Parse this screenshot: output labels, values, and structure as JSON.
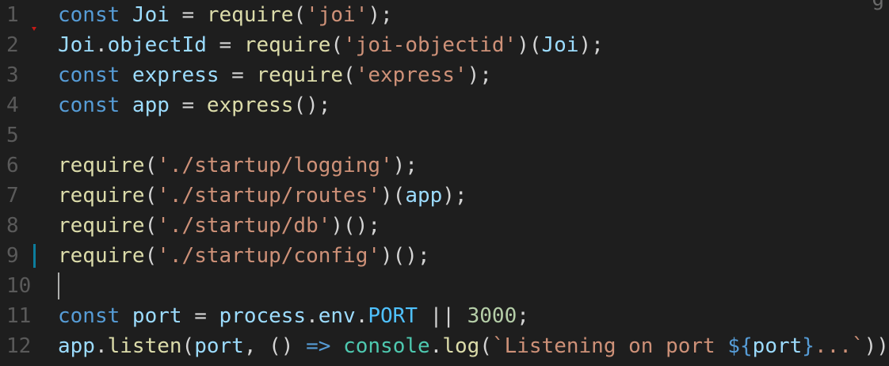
{
  "editor": {
    "corner_glyph": "g",
    "lines": [
      {
        "number": "1",
        "tokens": [
          [
            "k",
            "const "
          ],
          [
            "v",
            "Joi"
          ],
          [
            "p",
            " = "
          ],
          [
            "f",
            "require"
          ],
          [
            "p",
            "("
          ],
          [
            "s",
            "'joi'"
          ],
          [
            "p",
            ");"
          ]
        ]
      },
      {
        "number": "2",
        "tokens": [
          [
            "v",
            "Joi"
          ],
          [
            "p",
            "."
          ],
          [
            "v",
            "objectId"
          ],
          [
            "p",
            " = "
          ],
          [
            "f",
            "require"
          ],
          [
            "p",
            "("
          ],
          [
            "s",
            "'joi-objectid'"
          ],
          [
            "p",
            ")("
          ],
          [
            "v",
            "Joi"
          ],
          [
            "p",
            ");"
          ]
        ]
      },
      {
        "number": "3",
        "tokens": [
          [
            "k",
            "const "
          ],
          [
            "v",
            "express"
          ],
          [
            "p",
            " = "
          ],
          [
            "f",
            "require"
          ],
          [
            "p",
            "("
          ],
          [
            "s",
            "'express'"
          ],
          [
            "p",
            ");"
          ]
        ]
      },
      {
        "number": "4",
        "tokens": [
          [
            "k",
            "const "
          ],
          [
            "v",
            "app"
          ],
          [
            "p",
            " = "
          ],
          [
            "f",
            "express"
          ],
          [
            "p",
            "();"
          ]
        ]
      },
      {
        "number": "5",
        "tokens": []
      },
      {
        "number": "6",
        "tokens": [
          [
            "f",
            "require"
          ],
          [
            "p",
            "("
          ],
          [
            "s",
            "'./startup/logging'"
          ],
          [
            "p",
            ");"
          ]
        ]
      },
      {
        "number": "7",
        "tokens": [
          [
            "f",
            "require"
          ],
          [
            "p",
            "("
          ],
          [
            "s",
            "'./startup/routes'"
          ],
          [
            "p",
            ")("
          ],
          [
            "v",
            "app"
          ],
          [
            "p",
            ");"
          ]
        ]
      },
      {
        "number": "8",
        "tokens": [
          [
            "f",
            "require"
          ],
          [
            "p",
            "("
          ],
          [
            "s",
            "'./startup/db'"
          ],
          [
            "p",
            ")();"
          ]
        ]
      },
      {
        "number": "9",
        "tokens": [
          [
            "f",
            "require"
          ],
          [
            "p",
            "("
          ],
          [
            "s",
            "'./startup/config'"
          ],
          [
            "p",
            ")();"
          ]
        ]
      },
      {
        "number": "10",
        "tokens": []
      },
      {
        "number": "11",
        "tokens": [
          [
            "k",
            "const "
          ],
          [
            "v",
            "port"
          ],
          [
            "p",
            " = "
          ],
          [
            "v",
            "process"
          ],
          [
            "p",
            "."
          ],
          [
            "v",
            "env"
          ],
          [
            "p",
            "."
          ],
          [
            "c",
            "PORT"
          ],
          [
            "p",
            " || "
          ],
          [
            "n",
            "3000"
          ],
          [
            "p",
            ";"
          ]
        ]
      },
      {
        "number": "12",
        "tokens": [
          [
            "v",
            "app"
          ],
          [
            "p",
            "."
          ],
          [
            "f",
            "listen"
          ],
          [
            "p",
            "("
          ],
          [
            "v",
            "port"
          ],
          [
            "p",
            ", () "
          ],
          [
            "k",
            "=>"
          ],
          [
            "p",
            " "
          ],
          [
            "t",
            "console"
          ],
          [
            "p",
            "."
          ],
          [
            "f",
            "log"
          ],
          [
            "p",
            "("
          ],
          [
            "s",
            "`Listening on port "
          ],
          [
            "k",
            "${"
          ],
          [
            "v",
            "port"
          ],
          [
            "k",
            "}"
          ],
          [
            "s",
            "...`"
          ],
          [
            "p",
            "));"
          ]
        ]
      }
    ],
    "modified_line": "9",
    "deleted_marker_after_line": "1",
    "cursor_line": "10",
    "colors": {
      "background": "#1e1e1e",
      "keyword": "#569cd6",
      "variable": "#9cdcfe",
      "function": "#dcdcaa",
      "string": "#ce9178",
      "number": "#b5cea8",
      "type": "#4ec9b0",
      "constant": "#4fc1ff",
      "gutter_modified": "#0c7d9d",
      "gutter_deleted": "#c41a16"
    }
  }
}
